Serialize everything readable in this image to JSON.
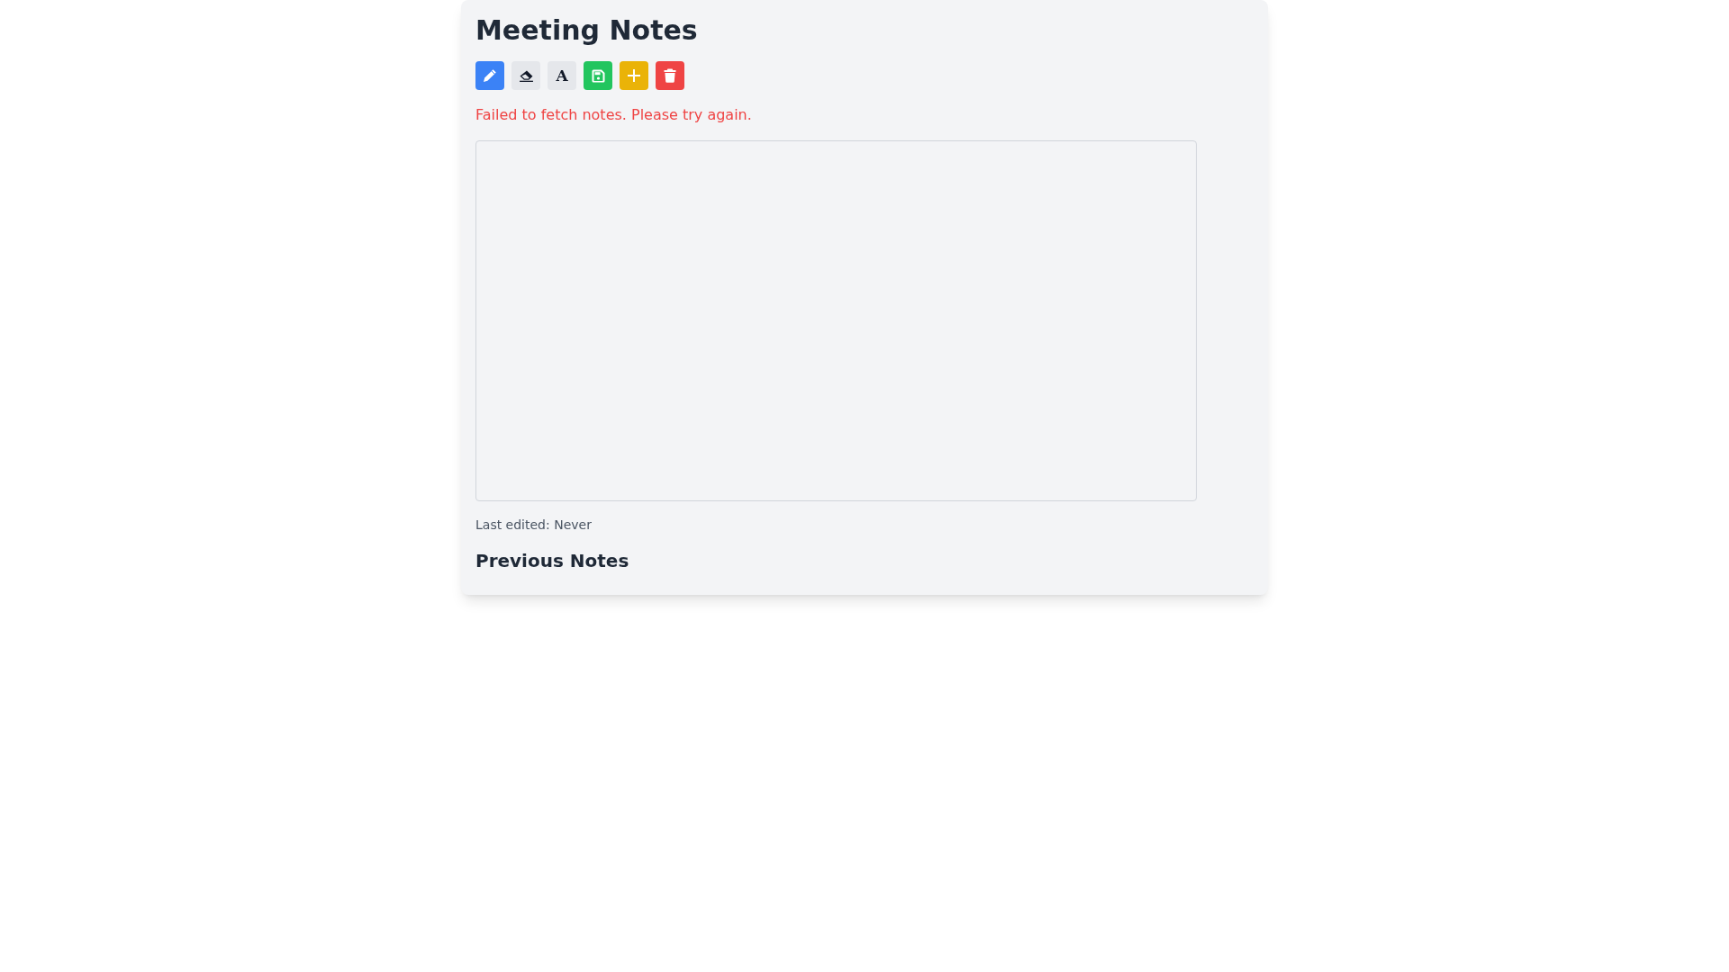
{
  "title": "Meeting Notes",
  "toolbar": [
    {
      "kind": "edit"
    },
    {
      "kind": "erase"
    },
    {
      "kind": "font",
      "glyph": "A"
    },
    {
      "kind": "save"
    },
    {
      "kind": "add"
    },
    {
      "kind": "delete"
    }
  ],
  "error": "Failed to fetch notes. Please try again.",
  "last_edited": "Last edited: Never",
  "previous_notes": {
    "heading": "Previous Notes"
  }
}
